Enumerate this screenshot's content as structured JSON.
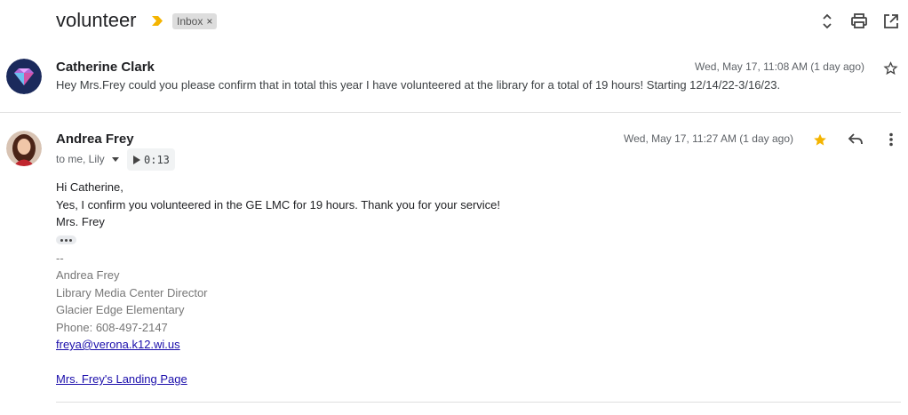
{
  "thread": {
    "subject": "volunteer",
    "label": "Inbox",
    "label_remove": "×"
  },
  "message1": {
    "sender": "Catherine Clark",
    "date": "Wed, May 17, 11:08 AM (1 day ago)",
    "snippet": "Hey Mrs.Frey could you please confirm that in total this year I have volunteered at the library for a total of 19 hours! Starting 12/14/22-3/16/23."
  },
  "message2": {
    "sender": "Andrea Frey",
    "date": "Wed, May 17, 11:27 AM (1 day ago)",
    "recipients": "to me, Lily",
    "audio_time": "0:13",
    "body": [
      "Hi Catherine,",
      "Yes, I confirm you volunteered in the GE LMC for 19 hours. Thank you for your service!",
      "Mrs. Frey"
    ],
    "signature": {
      "separator": "--",
      "name": "Andrea Frey",
      "title": "Library Media Center Director",
      "school": "Glacier Edge Elementary",
      "phone": "Phone: 608-497-2147",
      "email": "freya@verona.k12.wi.us",
      "landing_link": "Mrs. Frey's Landing Page"
    }
  },
  "colors": {
    "star_filled": "#f4b400",
    "importance": "#f4b400",
    "link": "#1a0dab"
  },
  "icons": [
    "importance-marker-icon",
    "expand-collapse-icon",
    "print-icon",
    "open-new-window-icon",
    "star-icon",
    "reply-icon",
    "more-vert-icon",
    "dropdown-arrow-icon",
    "play-icon"
  ]
}
